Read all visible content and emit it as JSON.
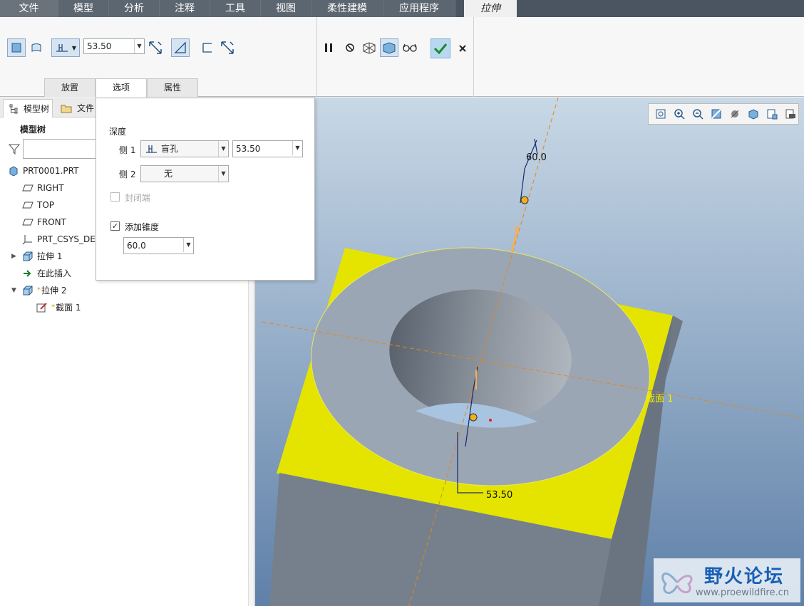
{
  "menubar": {
    "file": "文件",
    "tabs": [
      "模型",
      "分析",
      "注释",
      "工具",
      "视图",
      "柔性建模",
      "应用程序"
    ],
    "active_tab": "拉伸"
  },
  "ribbon": {
    "depth_value": "53.50",
    "subtabs": [
      "放置",
      "选项",
      "属性"
    ],
    "active_subtab": "选项"
  },
  "left_panel": {
    "tab_model_tree": "模型树",
    "tab_folder": "文件夹",
    "heading": "模型树",
    "tree": [
      {
        "label": "PRT0001.PRT",
        "icon": "part-icon",
        "indent": 0
      },
      {
        "label": "RIGHT",
        "icon": "datum-plane-icon",
        "indent": 1
      },
      {
        "label": "TOP",
        "icon": "datum-plane-icon",
        "indent": 1
      },
      {
        "label": "FRONT",
        "icon": "datum-plane-icon",
        "indent": 1
      },
      {
        "label": "PRT_CSYS_DEF",
        "icon": "csys-icon",
        "indent": 1
      },
      {
        "label": "拉伸 1",
        "icon": "extrude-icon",
        "indent": 1
      },
      {
        "label": "在此插入",
        "icon": "insert-arrow-icon",
        "indent": 1
      },
      {
        "label": "拉伸 2",
        "icon": "extrude-icon",
        "indent": 1
      },
      {
        "label": "截面 1",
        "icon": "sketch-icon",
        "indent": 2
      }
    ]
  },
  "options_panel": {
    "depth_heading": "深度",
    "side1_label": "侧 1",
    "side1_type": "盲孔",
    "side1_value": "53.50",
    "side2_label": "侧 2",
    "side2_type": "无",
    "capped_ends": "封闭端",
    "capped_checked": false,
    "add_taper": "添加锥度",
    "taper_checked": true,
    "taper_value": "60.0"
  },
  "viewport": {
    "dim_depth": "53.50",
    "dim_taper": "60.0",
    "section_label": "截面 1",
    "colors": {
      "background_top": "#c8d8e6",
      "background_bottom": "#5f80a8",
      "body": "#e4e400",
      "ring_face": "#9ba6b4",
      "side_face": "#6f7984"
    }
  },
  "watermark": {
    "title": "野火论坛",
    "url": "www.proewildfire.cn"
  }
}
